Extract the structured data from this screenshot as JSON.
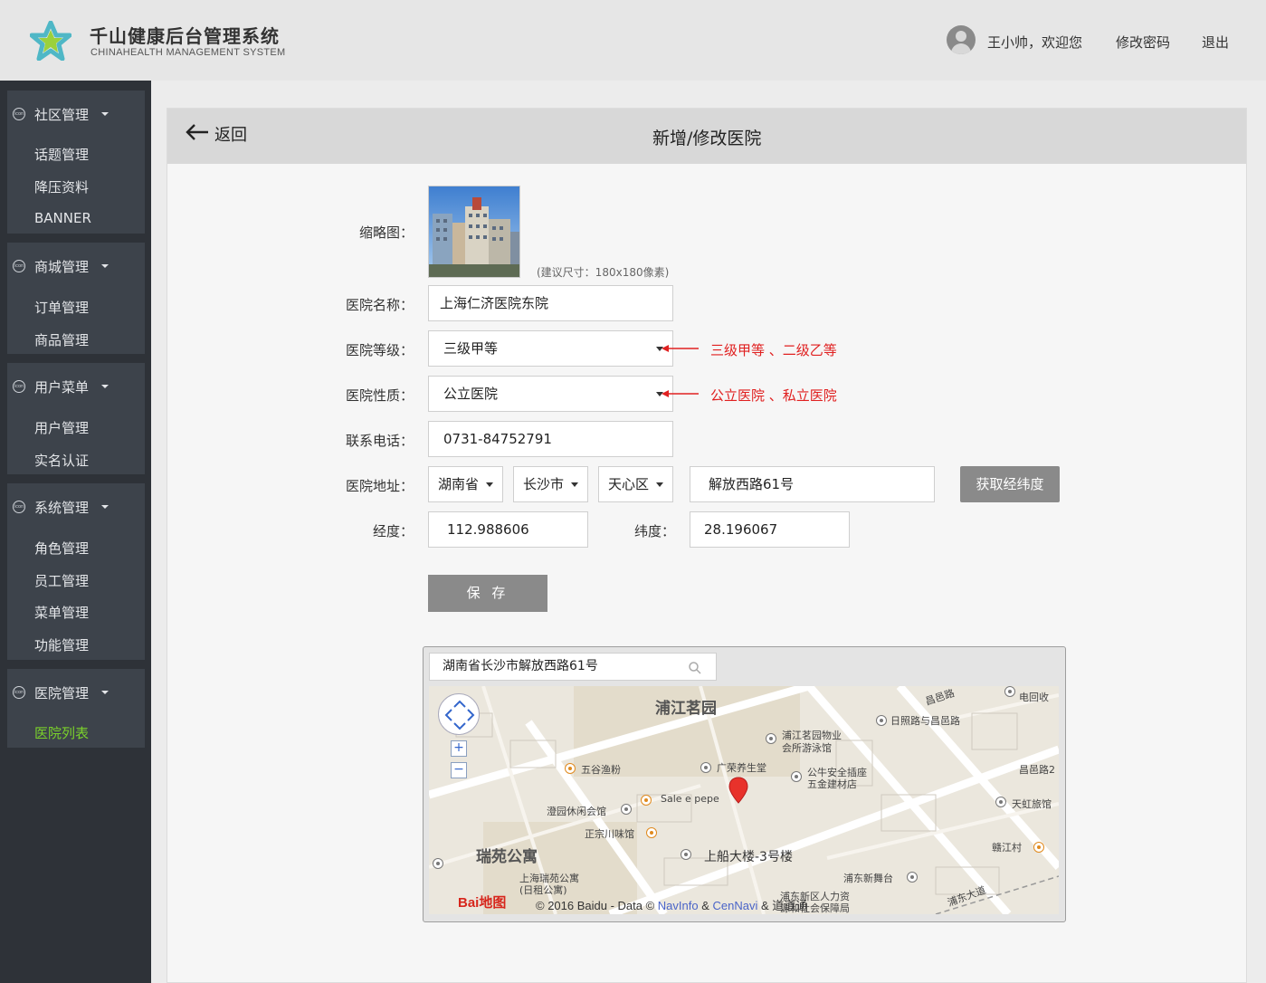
{
  "header": {
    "title_cn": "千山健康后台管理系统",
    "title_en": "CHINAHEALTH  MANAGEMENT SYSTEM",
    "welcome": "王小帅，欢迎您",
    "change_password": "修改密码",
    "logout": "退出"
  },
  "sidebar": {
    "icon_text": "icon",
    "groups": [
      {
        "title": "社区管理",
        "items": [
          "话题管理",
          "降压资料",
          "BANNER"
        ]
      },
      {
        "title": "商城管理",
        "items": [
          "订单管理",
          "商品管理"
        ]
      },
      {
        "title": "用户菜单",
        "items": [
          "用户管理",
          "实名认证"
        ]
      },
      {
        "title": "系统管理",
        "items": [
          "角色管理",
          "员工管理",
          "菜单管理",
          "功能管理"
        ]
      },
      {
        "title": "医院管理",
        "items": [
          "医院列表"
        ]
      }
    ],
    "active_item": "医院列表"
  },
  "panel": {
    "back": "返回",
    "title": "新增/修改医院"
  },
  "form": {
    "thumbnail_label": "缩略图：",
    "size_hint": "(建议尺寸：180x180像素)",
    "name_label": "医院名称：",
    "name_value": "上海仁济医院东院",
    "level_label": "医院等级：",
    "level_value": "三级甲等",
    "level_note": "三级甲等 、二级乙等",
    "nature_label": "医院性质：",
    "nature_value": "公立医院",
    "nature_note": "公立医院 、私立医院",
    "phone_label": "联系电话：",
    "phone_value": "0731-84752791",
    "address_label": "医院地址：",
    "province": "湖南省",
    "city": "长沙市",
    "district": "天心区",
    "street": "解放西路61号",
    "geo_button": "获取经纬度",
    "lng_label": "经度：",
    "lng_value": "112.988606",
    "lat_label": "纬度：",
    "lat_value": "28.196067",
    "save_button": "保 存"
  },
  "map": {
    "search_value": "湖南省长沙市解放西路61号",
    "labels": {
      "pujiang": "浦江茗园",
      "ruiyuan": "瑞苑公寓",
      "changyi": "昌邑路",
      "rizhao": "日照路与昌邑路",
      "wuye": "浦江茗园物业",
      "youyong": "会所游泳馆",
      "wugu": "五谷渔粉",
      "guangrong": "广荣养生堂",
      "gongniu": "公牛安全插座",
      "wujin": "五金建材店",
      "sale": "Sale e pepe",
      "chengyuan": "澄园休闲会馆",
      "zhengzong": "正宗川味馆",
      "shangchuan": "上船大楼-3号楼",
      "tianhong": "天虹旅馆",
      "ganjiang": "赣江村",
      "ruiyuan_apt": "上海瑞苑公寓",
      "rizu": "(日租公寓)",
      "pudong_wutai": "浦东新舞台",
      "pudong_rl": "浦东新区人力资",
      "shebao": "源和社会保障局",
      "pudong_ave": "浦东大道",
      "changyi2": "昌邑路2",
      "dianhui": "电回收"
    },
    "baidu_text": "Bai地图",
    "copyright_prefix": "© 2016 Baidu - Data © ",
    "copyright_navinfo": "NavInfo",
    "copyright_amp": " & ",
    "copyright_cennavi": "CenNavi",
    "copyright_suffix": " & 道道通"
  },
  "colors": {
    "accent_green": "#7ad12b",
    "note_red": "#e02020",
    "button_gray": "#8a8a8a",
    "sidebar_bg": "#2e3238"
  }
}
